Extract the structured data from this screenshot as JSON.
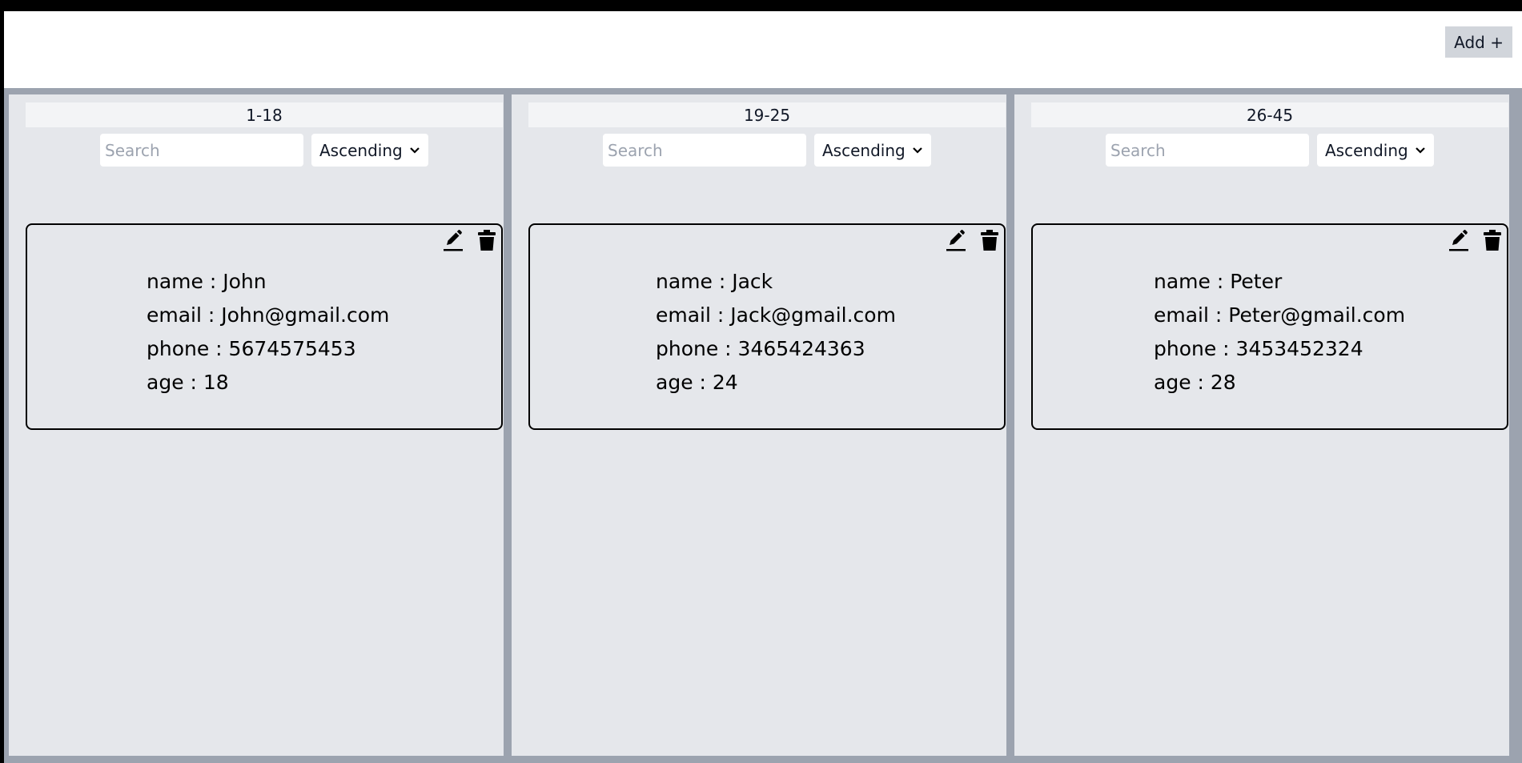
{
  "header": {
    "add_button_label": "Add +"
  },
  "columns": [
    {
      "range_label": "1-18",
      "search_placeholder": "Search",
      "sort_value": "Ascending",
      "cards": [
        {
          "name_label": "name : John",
          "email_label": "email : John@gmail.com",
          "phone_label": "phone : 5674575453",
          "age_label": "age : 18"
        }
      ]
    },
    {
      "range_label": "19-25",
      "search_placeholder": "Search",
      "sort_value": "Ascending",
      "cards": [
        {
          "name_label": "name : Jack",
          "email_label": "email : Jack@gmail.com",
          "phone_label": "phone : 3465424363",
          "age_label": "age : 24"
        }
      ]
    },
    {
      "range_label": "26-45",
      "search_placeholder": "Search",
      "sort_value": "Ascending",
      "cards": [
        {
          "name_label": "name : Peter",
          "email_label": "email : Peter@gmail.com",
          "phone_label": "phone : 3453452324",
          "age_label": "age : 28"
        }
      ]
    }
  ],
  "icons": {
    "edit": "pencil-icon",
    "delete": "trash-icon",
    "dropdown": "chevron-down-icon"
  },
  "colors": {
    "board_background": "#9ca3af",
    "column_background": "#e5e7eb",
    "add_button_background": "#d1d5db"
  }
}
